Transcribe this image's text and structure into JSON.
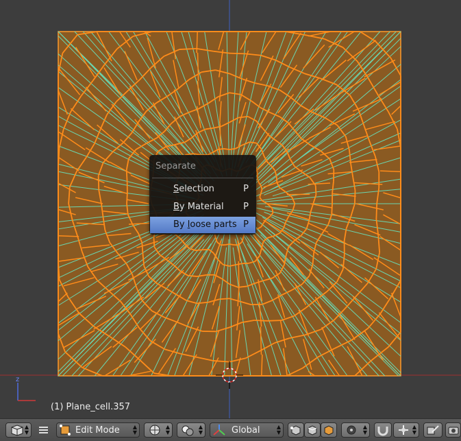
{
  "menu": {
    "title": "Separate",
    "items": [
      {
        "pre": "",
        "u": "S",
        "post": "election",
        "shortcut": "P",
        "active": false
      },
      {
        "pre": "",
        "u": "B",
        "post": "y Material",
        "shortcut": "P",
        "active": false
      },
      {
        "pre": "By ",
        "u": "l",
        "post": "oose parts",
        "shortcut": "P",
        "active": true
      }
    ]
  },
  "viewport": {
    "object_info": "(1) Plane_cell.357",
    "axis_label": "z"
  },
  "header": {
    "mode_label": "Edit Mode",
    "orientation_label": "Global"
  },
  "colors": {
    "face": "#8a5a22",
    "edge_orange": "#ff8c1a",
    "edge_seam": "#6ad6b0",
    "highlight": "#5680d0"
  },
  "icons": [
    "editor-type-icon",
    "menu-icon",
    "edit-mode-icon",
    "viewport-shading-icon",
    "pivot-icon",
    "manipulator-icon",
    "vertex-select-icon",
    "edge-select-icon",
    "face-select-icon",
    "proportional-icon",
    "snap-magnet-icon",
    "snap-target-icon",
    "overlay-icon",
    "render-icon"
  ]
}
